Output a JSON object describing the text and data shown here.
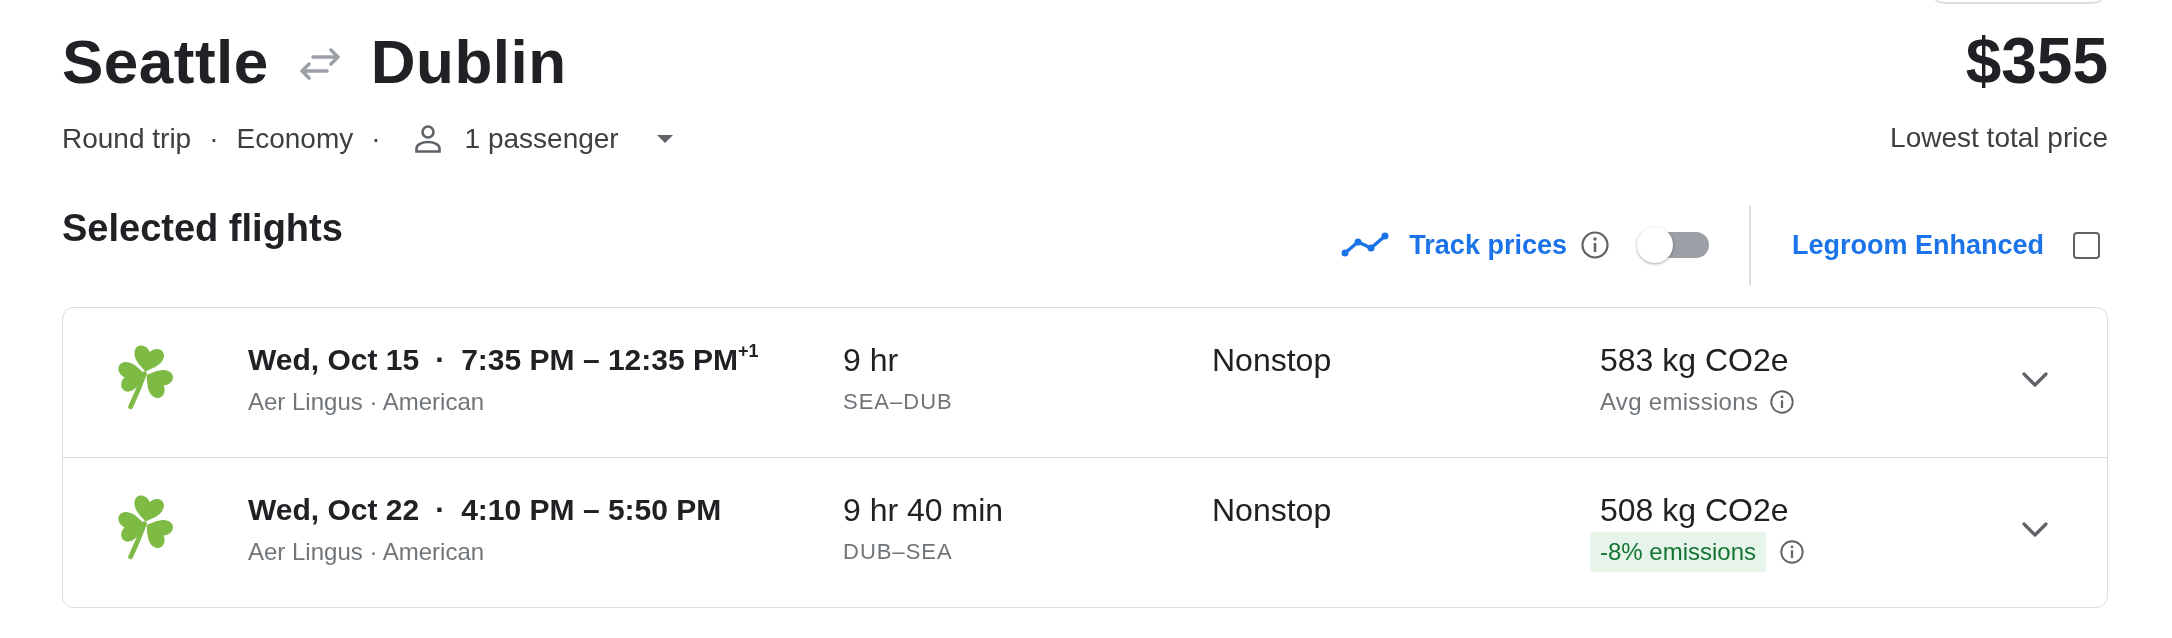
{
  "route": {
    "origin": "Seattle",
    "destination": "Dublin"
  },
  "trip_options": [
    {
      "kind": "text",
      "label": "Round trip",
      "separator": "·"
    },
    {
      "kind": "text",
      "label": "Economy",
      "separator": "·"
    },
    {
      "kind": "passengers",
      "label": "1 passenger"
    }
  ],
  "price": {
    "amount": "$355",
    "caption": "Lowest total price"
  },
  "section": {
    "title": "Selected flights"
  },
  "track_prices": {
    "label": "Track prices",
    "on": false
  },
  "legroom": {
    "label": "Legroom Enhanced",
    "checked": false
  },
  "flights": [
    {
      "date": "Wed, Oct 15",
      "separator": "·",
      "times": "7:35 PM – 12:35 PM$^{+1}$",
      "airlines": "Aer Lingus · American",
      "duration": "9 hr",
      "route": "SEA–DUB",
      "stops": "Nonstop",
      "emissions": "583 kg CO2e",
      "emissions_note": {
        "kind": "plain",
        "text": "Avg emissions"
      },
      "expanded": false
    },
    {
      "date": "Wed, Oct 22",
      "separator": "·",
      "times": "4:10 PM – 5:50 PM",
      "airlines": "Aer Lingus · American",
      "duration": "9 hr 40 min",
      "route": "DUB–SEA",
      "stops": "Nonstop",
      "emissions": "508 kg CO2e",
      "emissions_note": {
        "kind": "badge",
        "text": "-8% emissions"
      },
      "expanded": false
    }
  ]
}
